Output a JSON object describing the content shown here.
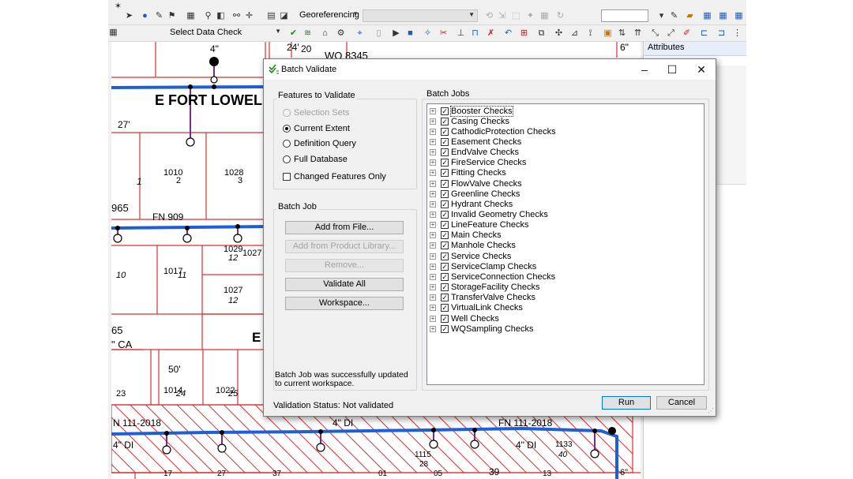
{
  "toolbar": {
    "georeferencing_label": "Georeferencing",
    "select_data_check_label": "Select Data Check"
  },
  "attributes": {
    "title": "Attributes"
  },
  "map": {
    "labels": [
      "4\"",
      "24'",
      "20",
      "WO 8345",
      "6\"",
      "E FORT LOWEL",
      "27'",
      "1010",
      "2",
      "1028",
      "3",
      "1",
      "965",
      "FN 909",
      "1029",
      "12",
      "1027",
      "10",
      "1017",
      "11",
      "1027",
      "12",
      "65",
      "\" CA",
      "E",
      "50'",
      "23",
      "1014",
      "24",
      "1022",
      "25",
      "N 111-2018",
      "4\" DI",
      "4\" DI",
      "FN 111-2018",
      "4\" DI",
      "1115",
      "28",
      "1133",
      "40",
      "39",
      "17",
      "27",
      "37",
      "01",
      "05",
      "13",
      "6\""
    ]
  },
  "dialog": {
    "title": "Batch Validate",
    "features_to_validate": {
      "legend": "Features to Validate",
      "options": [
        {
          "label": "Selection Sets",
          "selected": false,
          "enabled": false
        },
        {
          "label": "Current Extent",
          "selected": true,
          "enabled": true
        },
        {
          "label": "Definition Query",
          "selected": false,
          "enabled": true
        },
        {
          "label": "Full Database",
          "selected": false,
          "enabled": true
        }
      ],
      "changed_only_label": "Changed Features Only"
    },
    "batch_job": {
      "legend": "Batch Job",
      "add_from_file": "Add from File...",
      "add_from_product_library": "Add from Product Library...",
      "remove": "Remove...",
      "validate_all": "Validate All",
      "workspace": "Workspace...",
      "message": "Batch Job was successfully updated to current workspace."
    },
    "batch_jobs": {
      "legend": "Batch Jobs",
      "items": [
        "Booster Checks",
        "Casing Checks",
        "CathodicProtection Checks",
        "Easement Checks",
        "EndValve Checks",
        "FireService Checks",
        "Fitting Checks",
        "FlowValve Checks",
        "Greenline Checks",
        "Hydrant Checks",
        "Invalid Geometry Checks",
        "LineFeature Checks",
        "Main Checks",
        "Manhole Checks",
        "Service Checks",
        "ServiceClamp Checks",
        "ServiceConnection Checks",
        "StorageFacility Checks",
        "TransferValve Checks",
        "VirtualLink Checks",
        "Well Checks",
        "WQSampling Checks"
      ]
    },
    "status": "Validation Status: Not validated",
    "run": "Run",
    "cancel": "Cancel"
  },
  "colors": {
    "parcel_line": "#d93030",
    "water_main": "#1e5fd6",
    "service_line": "#7a2a8a",
    "dialog_bg": "#f0f0f0"
  }
}
